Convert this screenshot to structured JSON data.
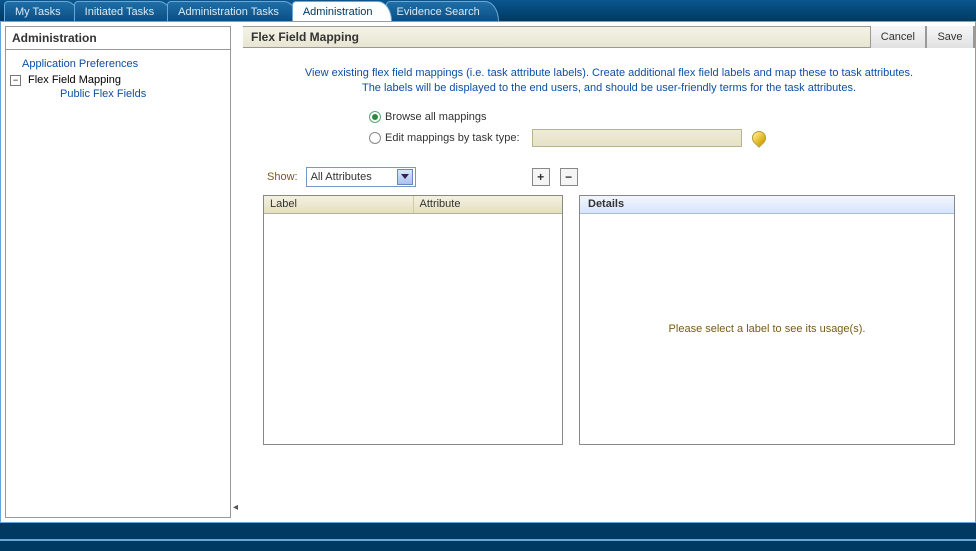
{
  "tabs": {
    "my_tasks": "My Tasks",
    "initiated_tasks": "Initiated Tasks",
    "administration_tasks": "Administration Tasks",
    "administration": "Administration",
    "evidence_search": "Evidence Search"
  },
  "sidebar": {
    "title": "Administration",
    "app_prefs": "Application Preferences",
    "flex_field_mapping": "Flex Field Mapping",
    "public_flex_fields": "Public Flex Fields"
  },
  "header": {
    "title": "Flex Field Mapping",
    "cancel": "Cancel",
    "save": "Save"
  },
  "intro": {
    "line1": "View existing flex field mappings (i.e. task attribute labels). Create additional flex field labels and map these to task attributes.",
    "line2": "The labels will be displayed to the end users, and should be user-friendly terms for the task attributes."
  },
  "radio": {
    "browse_all": "Browse all mappings",
    "by_task_type": "Edit mappings by task type:"
  },
  "show": {
    "label": "Show:",
    "selected": "All Attributes"
  },
  "grid": {
    "col_label": "Label",
    "col_attribute": "Attribute"
  },
  "details": {
    "title": "Details",
    "empty": "Please select a label to see its usage(s)."
  },
  "icons": {
    "plus": "+",
    "minus": "−"
  }
}
